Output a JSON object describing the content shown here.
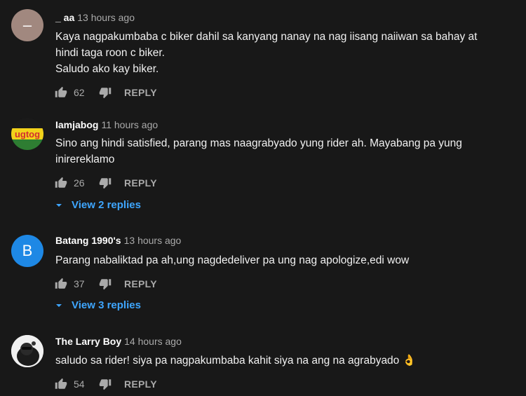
{
  "comments": [
    {
      "author": "_ aa",
      "time": "13 hours ago",
      "avatar_letter": "–",
      "lines": [
        "Kaya nagpakumbaba c biker dahil sa kanyang nanay na nag iisang naiiwan sa bahay at",
        "hindi taga roon c biker.",
        "Saludo ako kay biker."
      ],
      "likes": "62",
      "reply_label": "REPLY"
    },
    {
      "author": "Iamjabog",
      "time": "11 hours ago",
      "avatar_text": "ugtog",
      "lines": [
        "Sino ang hindi satisfied, parang mas naagrabyado yung rider ah. Mayabang pa yung",
        "inirereklamo"
      ],
      "likes": "26",
      "reply_label": "REPLY",
      "replies_label": "View 2 replies"
    },
    {
      "author": "Batang 1990's",
      "time": "13 hours ago",
      "avatar_letter": "B",
      "lines": [
        "Parang nabaliktad pa ah,ung nagdedeliver pa ung nag apologize,edi wow"
      ],
      "likes": "37",
      "reply_label": "REPLY",
      "replies_label": "View 3 replies"
    },
    {
      "author": "The Larry Boy",
      "time": "14 hours ago",
      "lines": [
        "saludo sa rider! siya pa nagpakumbaba kahit siya na ang na agrabyado 👌"
      ],
      "likes": "54",
      "reply_label": "REPLY"
    }
  ],
  "colors": {
    "background": "#181818",
    "link": "#3ea6ff",
    "secondary_text": "#aaaaaa",
    "avatar_aa": "#a1887f",
    "avatar_b": "#1e88e5"
  }
}
